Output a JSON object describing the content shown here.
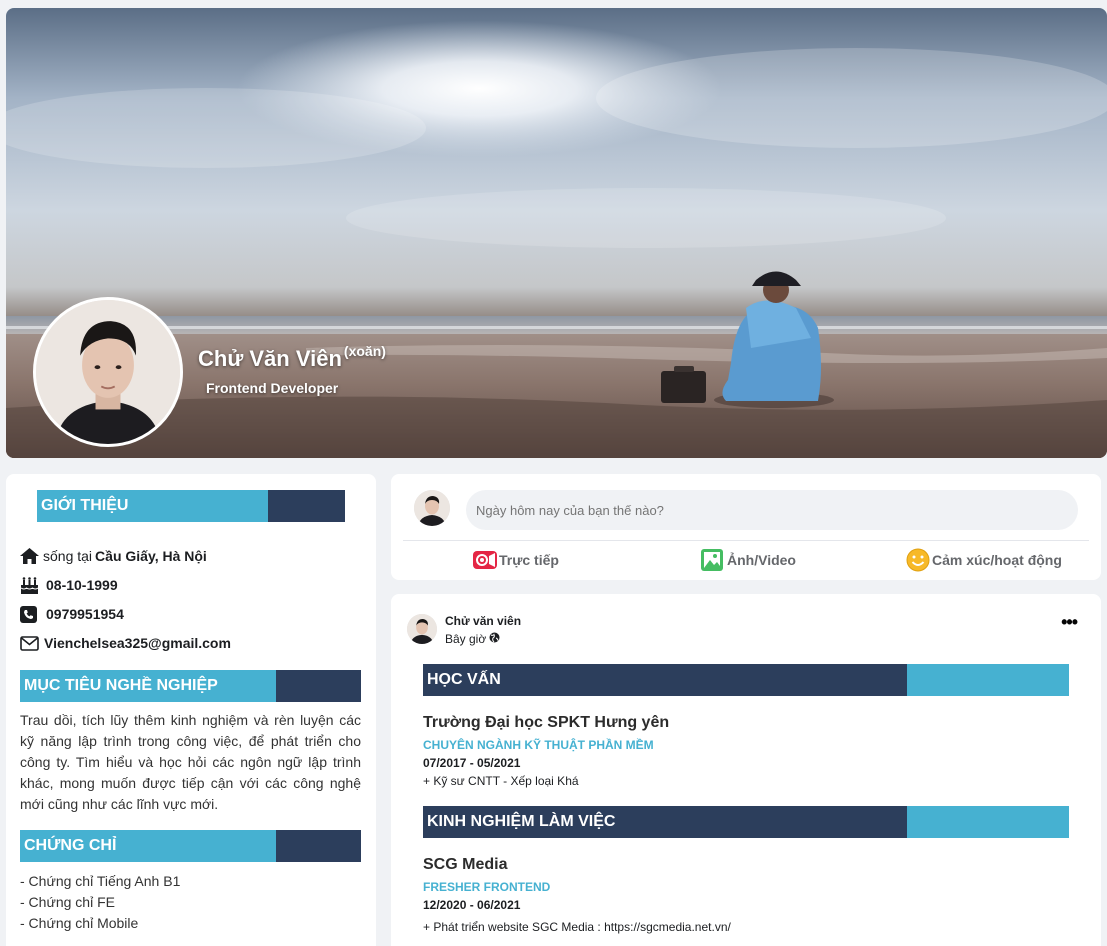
{
  "profile": {
    "name": "Chử Văn Viên",
    "nickname": "(xoăn)",
    "role": "Frontend Developer"
  },
  "intro": {
    "title": "GIỚI THIỆU",
    "location_prefix": "sống tại",
    "location": "Cầu Giấy, Hà Nội",
    "birthday": "08-10-1999",
    "phone": "0979951954",
    "email": "Vienchelsea325@gmail.com"
  },
  "career_goal": {
    "title": "MỤC TIÊU NGHỀ NGHIỆP",
    "text": "Trau dồi, tích lũy thêm kinh nghiệm và rèn luyện các kỹ năng lập trình trong công việc, để phát triển cho công ty. Tìm hiểu và học hỏi các ngôn ngữ lập trình khác, mong muốn được tiếp cận với các công nghệ mới cũng như các lĩnh vực mới."
  },
  "certificates": {
    "title": "CHỨNG CHỈ",
    "items": [
      "- Chứng chỉ Tiếng Anh B1",
      "- Chứng chỉ FE",
      "- Chứng chỉ Mobile"
    ]
  },
  "composer": {
    "placeholder": "Ngày hôm nay của bạn thế nào?",
    "actions": [
      "Trực tiếp",
      "Ảnh/Video",
      "Cảm xúc/hoạt động"
    ]
  },
  "post": {
    "author": "Chử văn viên",
    "time": "Bây giờ",
    "more": "•••",
    "education": {
      "title": "HỌC VẤN",
      "school": "Trường Đại học SPKT Hưng yên",
      "major": "CHUYÊN NGÀNH KỸ THUẬT PHẦN MỀM",
      "period": "07/2017 - 05/2021",
      "note": "+ Kỹ sư CNTT - Xếp loại Khá"
    },
    "experience": {
      "title": "KINH NGHIỆM LÀM VIỆC",
      "company": "SCG Media",
      "position": "FRESHER FRONTEND",
      "period": "12/2020 - 06/2021",
      "task_prefix": "+ Phát triển website SGC Media :",
      "task_link": "https://sgcmedia.net.vn/"
    }
  },
  "colors": {
    "accent_blue": "#46b1d1",
    "navy": "#2c3e5c",
    "background": "#f0f2f5"
  }
}
